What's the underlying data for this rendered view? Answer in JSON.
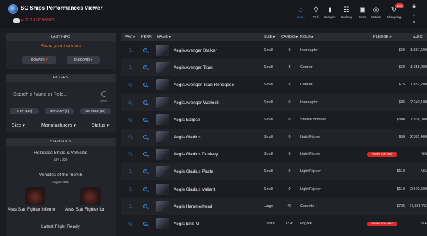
{
  "app": {
    "title": "SC Ships Performances Viewer",
    "version": "4.2.0.10098573"
  },
  "nav": [
    {
      "label": "Home",
      "icon": "home-icon",
      "glyph": "⌂",
      "active": true
    },
    {
      "label": "Perf.",
      "icon": "search-icon",
      "glyph": "⚲"
    },
    {
      "label": "Compare",
      "icon": "bar-chart-icon",
      "glyph": "▮"
    },
    {
      "label": "Ranking",
      "icon": "ranking-icon",
      "glyph": "☷"
    },
    {
      "label": "Items",
      "icon": "items-icon",
      "glyph": "▣"
    },
    {
      "label": "Metrics",
      "icon": "metrics-icon",
      "glyph": "◎"
    },
    {
      "label": "Changelog",
      "icon": "changelog-icon",
      "glyph": "↻",
      "badge": "101"
    }
  ],
  "side_icons": [
    "rss-icon",
    "light-mode-icon",
    "menu-icon"
  ],
  "last_info": {
    "header": "LAST INFO",
    "share": "Share your loadouts",
    "donate": "DONATE",
    "discord": "DISCORD"
  },
  "filters": {
    "header": "FILTERS",
    "search_placeholder": "Search a Name or Role...",
    "reset": "Reset",
    "pills": [
      "SHIP (182)",
      "GRAVLEV (9)",
      "VEHICLE (29)"
    ],
    "dropdowns": [
      "Size",
      "Manufacturers",
      "Status"
    ]
  },
  "statistics": {
    "header": "STATISTICS",
    "released_title": "Released Ships & Vehicles",
    "released_value": "184 / 220",
    "vehicle_month_title": "Vehicles of the month",
    "vehicle_month_date": "August 2025",
    "vehicles": [
      "Ares Star Fighter Inferno",
      "Ares Star Fighter Ion"
    ],
    "latest_flight": "Latest Flight Ready"
  },
  "table": {
    "headers": [
      "FAV. ▸",
      "PERF.",
      "NAME ▸",
      "SIZE ▸",
      "CARGO ▸",
      "ROLE ▸",
      "PLEDGE ▸",
      "aUEC"
    ],
    "rows": [
      {
        "name": "Aegis Avenger Stalker",
        "size": "Small",
        "cargo": "0",
        "role": "Interceptor",
        "pledge": "$60",
        "uec": "1,587,600"
      },
      {
        "name": "Aegis Avenger Titan",
        "size": "Small",
        "cargo": "8",
        "role": "Courier",
        "pledge": "$60",
        "uec": "1,358,280"
      },
      {
        "name": "Aegis Avenger Titan Renegade",
        "size": "Small",
        "cargo": "8",
        "role": "Courier",
        "pledge": "$75",
        "uec": "1,852,200"
      },
      {
        "name": "Aegis Avenger Warlock",
        "size": "Small",
        "cargo": "0",
        "role": "Interceptor",
        "pledge": "$85",
        "uec": "2,249,100"
      },
      {
        "name": "Aegis Eclipse",
        "size": "Small",
        "cargo": "0",
        "role": "Stealth Bomber",
        "pledge": "$300",
        "uec": "7,938,000"
      },
      {
        "name": "Aegis Gladius",
        "size": "Small",
        "cargo": "0",
        "role": "Light Fighter",
        "pledge": "$90",
        "uec": "2,381,400"
      },
      {
        "name": "Aegis Gladius Dunlevy",
        "size": "Small",
        "cargo": "0",
        "role": "Light Fighter",
        "pledge": "PROMOTION ONLY",
        "promo": true,
        "uec": "N/A"
      },
      {
        "name": "Aegis Gladius Pirate",
        "size": "Small",
        "cargo": "0",
        "role": "Light Fighter",
        "pledge": "$110",
        "uec": "N/A"
      },
      {
        "name": "Aegis Gladius Valiant",
        "size": "Small",
        "cargo": "0",
        "role": "Light Fighter",
        "pledge": "$110",
        "uec": "2,910,600"
      },
      {
        "name": "Aegis Hammerhead",
        "size": "Large",
        "cargo": "40",
        "role": "Corvette",
        "pledge": "$725",
        "uec": "47,958,750"
      },
      {
        "name": "Aegis Idris-M",
        "size": "Capital",
        "cargo": "1326",
        "role": "Frigate",
        "pledge": "PROMOTION ONLY",
        "promo": true,
        "uec": "N/A"
      }
    ]
  },
  "colors": {
    "accent": "#3d8fe8",
    "warning": "#e07a2a",
    "danger": "#d42a2a",
    "background": "#1c1d23"
  }
}
